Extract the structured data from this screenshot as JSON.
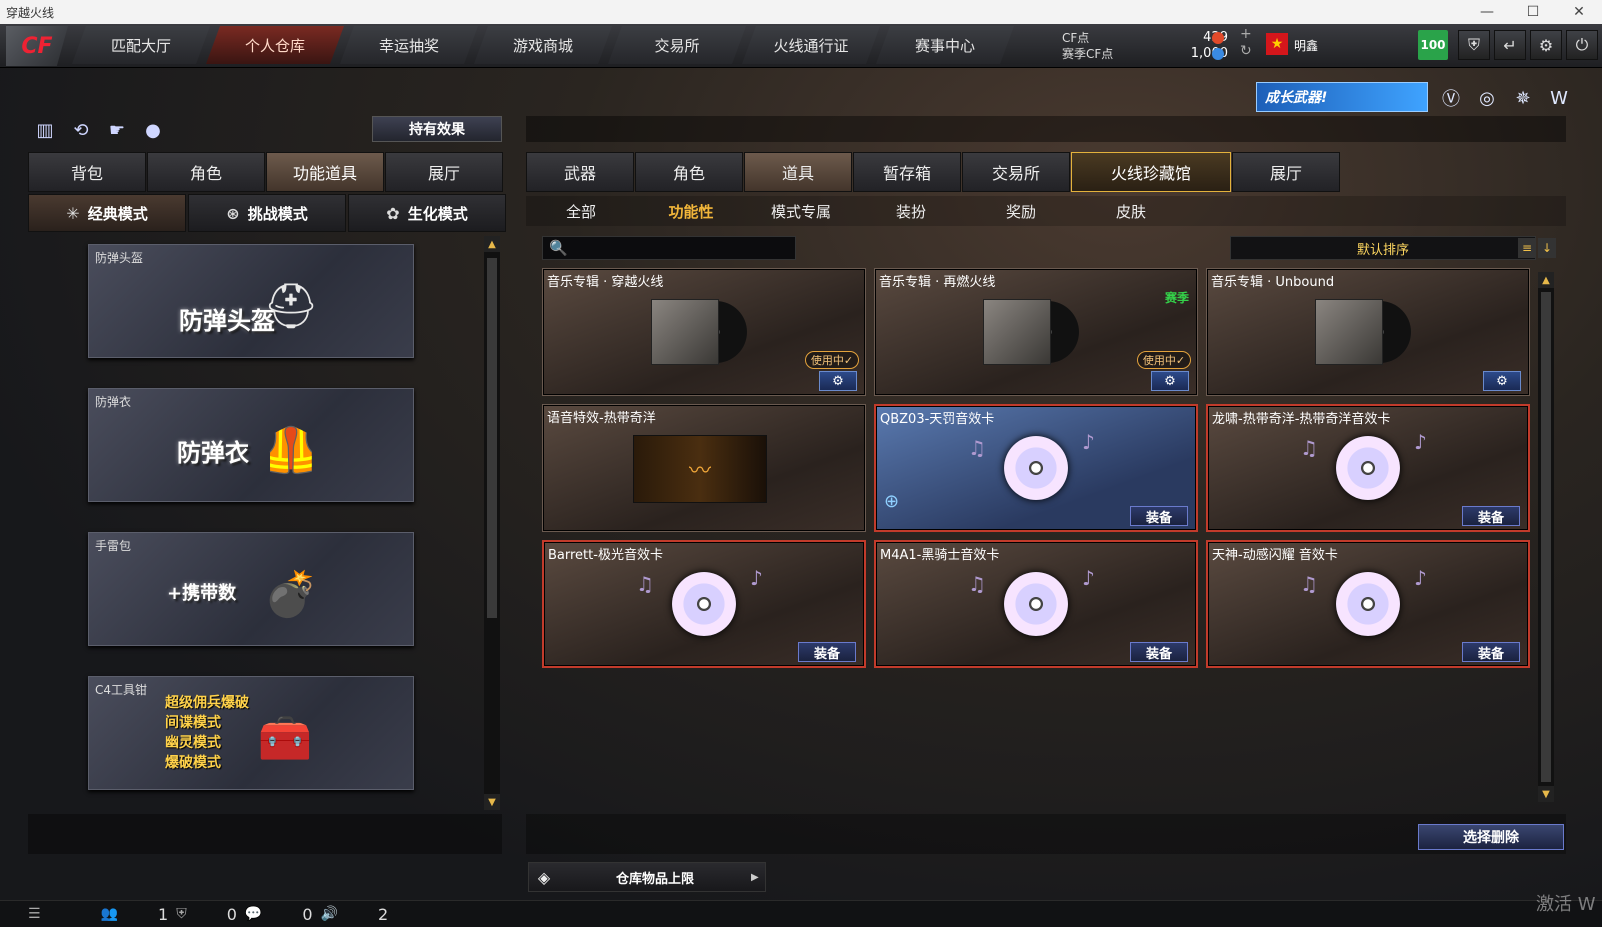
{
  "window": {
    "title": "穿越火线"
  },
  "nav": {
    "tabs": [
      {
        "label": "匹配大厅"
      },
      {
        "label": "个人仓库",
        "active": true
      },
      {
        "label": "幸运抽奖"
      },
      {
        "label": "游戏商城"
      },
      {
        "label": "交易所"
      },
      {
        "label": "火线通行证"
      },
      {
        "label": "赛事中心"
      }
    ],
    "cf_label": "CF点",
    "cf_value": "429",
    "match_label": "赛季CF点",
    "match_value": "1,000",
    "username": "明鑫",
    "level": "100"
  },
  "banner": {
    "text": "成长武器!"
  },
  "left": {
    "hold_effect_label": "持有效果",
    "tabs": [
      {
        "label": "背包"
      },
      {
        "label": "角色"
      },
      {
        "label": "功能道具",
        "active": true
      },
      {
        "label": "展厅"
      }
    ],
    "modes": [
      {
        "label": "经典模式",
        "active": true
      },
      {
        "label": "挑战模式"
      },
      {
        "label": "生化模式"
      }
    ],
    "items": [
      {
        "title": "防弹头盔",
        "big": "防弹头盔"
      },
      {
        "title": "防弹衣",
        "big": "防弹衣"
      },
      {
        "title": "手雷包",
        "big": "+携带数"
      },
      {
        "title": "C4工具钳",
        "lines": [
          "超级佣兵爆破",
          "间谍模式",
          "幽灵模式",
          "爆破模式"
        ]
      }
    ]
  },
  "right": {
    "tabs": [
      {
        "label": "武器"
      },
      {
        "label": "角色"
      },
      {
        "label": "道具",
        "active": true
      },
      {
        "label": "暂存箱"
      },
      {
        "label": "交易所"
      },
      {
        "label": "火线珍藏馆",
        "highlight": true
      },
      {
        "label": "展厅"
      }
    ],
    "subtabs": [
      {
        "label": "全部"
      },
      {
        "label": "功能性",
        "active": true
      },
      {
        "label": "模式专属"
      },
      {
        "label": "装扮"
      },
      {
        "label": "奖励"
      },
      {
        "label": "皮肤"
      }
    ],
    "search_placeholder": "",
    "sort_label": "默认排序",
    "cards": [
      {
        "title": "音乐专辑 · 穿越火线",
        "inuse": "使用中✓",
        "action": "gear"
      },
      {
        "title": "音乐专辑 · 再燃火线",
        "badge": "赛季",
        "inuse": "使用中✓",
        "action": "gear"
      },
      {
        "title": "音乐专辑 · Unbound",
        "action": "gear"
      },
      {
        "title": "语音特效-热带奇洋",
        "action": "none"
      },
      {
        "title": "QBZ03-天罚音效卡",
        "action": "equip",
        "equip_label": "装备"
      },
      {
        "title": "龙啸-热带奇洋-热带奇洋音效卡",
        "action": "equip",
        "equip_label": "装备"
      },
      {
        "title": "Barrett-极光音效卡",
        "action": "equip",
        "equip_label": "装备"
      },
      {
        "title": "M4A1-黑骑士音效卡",
        "action": "equip",
        "equip_label": "装备"
      },
      {
        "title": "天神-动感闪耀 音效卡",
        "action": "equip",
        "equip_label": "装备"
      }
    ],
    "delete_label": "选择删除",
    "storage_label": "仓库物品上限"
  },
  "status": {
    "friends": "1",
    "clan": "0",
    "chat": "0",
    "voice": "2"
  },
  "watermark": "激活 W",
  "colors": {
    "accent_gold": "#f2b63a",
    "active_nav": "#7a2a22",
    "equip_blue": "#2d3a6a",
    "level_green": "#2aa34a"
  }
}
